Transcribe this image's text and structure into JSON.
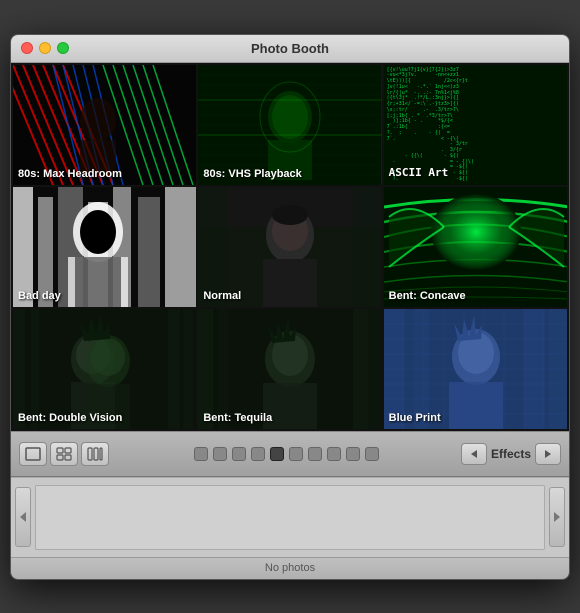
{
  "window": {
    "title": "Photo Booth"
  },
  "traffic_lights": {
    "close": "close",
    "minimize": "minimize",
    "maximize": "maximize"
  },
  "grid": {
    "cells": [
      {
        "id": "headroom",
        "label": "80s: Max Headroom",
        "type": "headroom"
      },
      {
        "id": "vhs",
        "label": "80s: VHS Playback",
        "type": "vhs"
      },
      {
        "id": "ascii",
        "label": "ASCII Art",
        "type": "ascii"
      },
      {
        "id": "badday",
        "label": "Bad day",
        "type": "badday"
      },
      {
        "id": "normal",
        "label": "Normal",
        "type": "normal"
      },
      {
        "id": "concave",
        "label": "Bent: Concave",
        "type": "concave"
      },
      {
        "id": "doublevision",
        "label": "Bent: Double Vision",
        "type": "doublevision"
      },
      {
        "id": "tequila",
        "label": "Bent: Tequila",
        "type": "tequila"
      },
      {
        "id": "blueprint",
        "label": "Blue Print",
        "type": "blueprint"
      }
    ]
  },
  "toolbar": {
    "view_single": "⊡",
    "view_grid": "⊞",
    "view_strip": "⊟",
    "effects_label": "Effects",
    "prev_icon": "◀",
    "next_icon": "▶",
    "dots": [
      false,
      false,
      false,
      false,
      true,
      false,
      false,
      false,
      false,
      false
    ]
  },
  "statusbar": {
    "text": "No photos"
  },
  "ascii_text": "[v!\\uu?7j1{v}[7{J})>3z7\n-vu<*3j?v.      -nn<+zz1\n\\tE)))[{           /2c<{r}t\n]v(!1u<   -.*.`  1nj<<)z3\nlr/{|u*  -. .:- 7n%1<j%8\n({t\\3j*  .!*/L.:3nj}>){]\n{r;+31</`-=:\\`.-}tz3>]{)\n\\s;:tr/     .-  .3/tr>7\\\n[;j;1b{  . *  .*3/tr>7\\\n  )];1b{ - .     *$/{<"
}
